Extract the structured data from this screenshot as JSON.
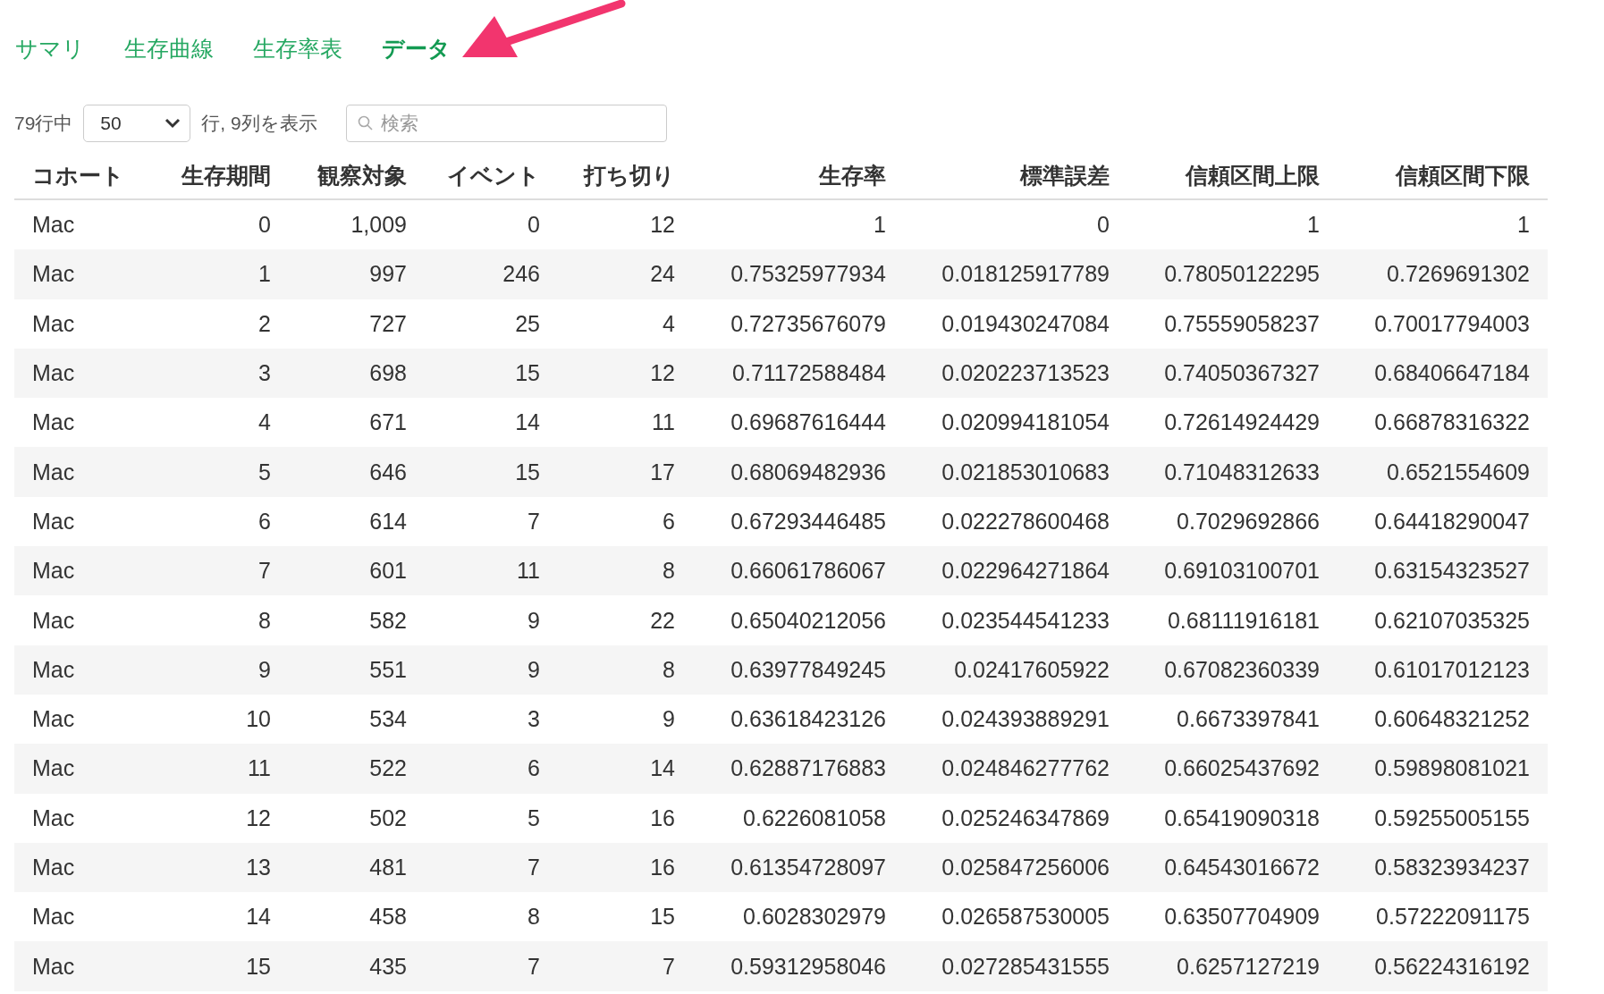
{
  "tabs": [
    {
      "label": "サマリ",
      "selected": false
    },
    {
      "label": "生存曲線",
      "selected": false
    },
    {
      "label": "生存率表",
      "selected": false
    },
    {
      "label": "データ",
      "selected": true
    }
  ],
  "toolbar": {
    "rows_prefix": "79行中",
    "page_size": "50",
    "rows_suffix": "行, 9列を表示",
    "search": {
      "placeholder": "検索"
    }
  },
  "table": {
    "columns": [
      "コホート",
      "生存期間",
      "観察対象",
      "イベント",
      "打ち切り",
      "生存率",
      "標準誤差",
      "信頼区間上限",
      "信頼区間下限"
    ],
    "rows": [
      [
        "Mac",
        "0",
        "1,009",
        "0",
        "12",
        "1",
        "0",
        "1",
        "1"
      ],
      [
        "Mac",
        "1",
        "997",
        "246",
        "24",
        "0.75325977934",
        "0.018125917789",
        "0.78050122295",
        "0.7269691302"
      ],
      [
        "Mac",
        "2",
        "727",
        "25",
        "4",
        "0.72735676079",
        "0.019430247084",
        "0.75559058237",
        "0.70017794003"
      ],
      [
        "Mac",
        "3",
        "698",
        "15",
        "12",
        "0.71172588484",
        "0.020223713523",
        "0.74050367327",
        "0.68406647184"
      ],
      [
        "Mac",
        "4",
        "671",
        "14",
        "11",
        "0.69687616444",
        "0.020994181054",
        "0.72614924429",
        "0.66878316322"
      ],
      [
        "Mac",
        "5",
        "646",
        "15",
        "17",
        "0.68069482936",
        "0.021853010683",
        "0.71048312633",
        "0.6521554609"
      ],
      [
        "Mac",
        "6",
        "614",
        "7",
        "6",
        "0.67293446485",
        "0.022278600468",
        "0.7029692866",
        "0.64418290047"
      ],
      [
        "Mac",
        "7",
        "601",
        "11",
        "8",
        "0.66061786067",
        "0.022964271864",
        "0.69103100701",
        "0.63154323527"
      ],
      [
        "Mac",
        "8",
        "582",
        "9",
        "22",
        "0.65040212056",
        "0.023544541233",
        "0.68111916181",
        "0.62107035325"
      ],
      [
        "Mac",
        "9",
        "551",
        "9",
        "8",
        "0.63977849245",
        "0.02417605922",
        "0.67082360339",
        "0.61017012123"
      ],
      [
        "Mac",
        "10",
        "534",
        "3",
        "9",
        "0.63618423126",
        "0.024393889291",
        "0.6673397841",
        "0.60648321252"
      ],
      [
        "Mac",
        "11",
        "522",
        "6",
        "14",
        "0.62887176883",
        "0.024846277762",
        "0.66025437692",
        "0.59898081021"
      ],
      [
        "Mac",
        "12",
        "502",
        "5",
        "16",
        "0.6226081058",
        "0.025246347869",
        "0.65419090318",
        "0.59255005155"
      ],
      [
        "Mac",
        "13",
        "481",
        "7",
        "16",
        "0.61354728097",
        "0.025847256006",
        "0.64543016672",
        "0.58323934237"
      ],
      [
        "Mac",
        "14",
        "458",
        "8",
        "15",
        "0.6028302979",
        "0.026587530005",
        "0.63507704909",
        "0.57222091175"
      ],
      [
        "Mac",
        "15",
        "435",
        "7",
        "7",
        "0.59312958046",
        "0.027285431555",
        "0.6257127219",
        "0.56224316192"
      ]
    ]
  }
}
